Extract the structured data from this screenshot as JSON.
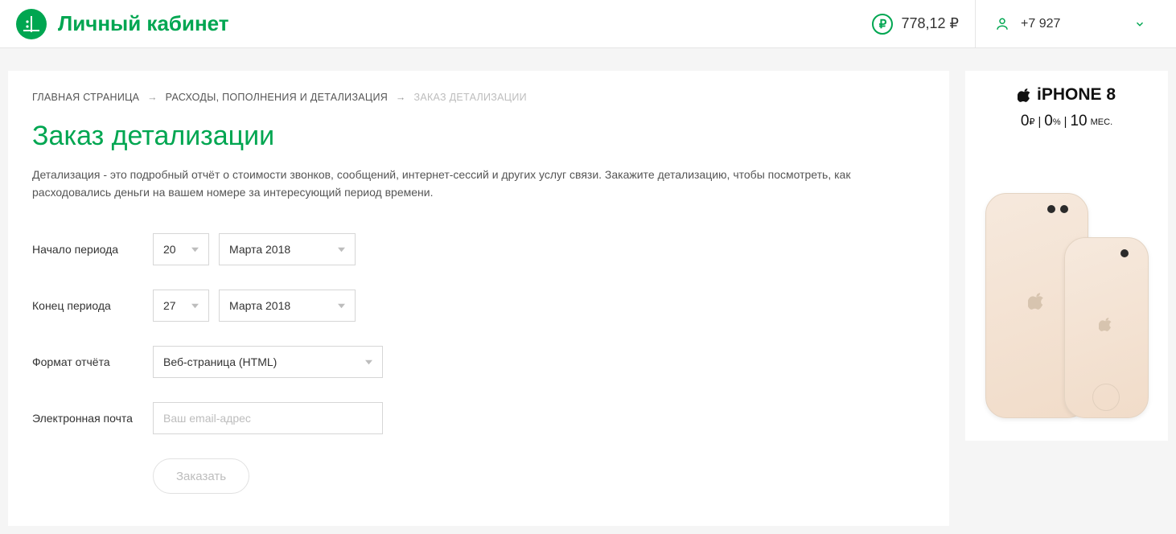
{
  "header": {
    "site_title": "Личный кабинет",
    "balance": "778,12 ₽",
    "account_phone": "+7 927"
  },
  "breadcrumbs": {
    "home": "ГЛАВНАЯ СТРАНИЦА",
    "section": "РАСХОДЫ, ПОПОЛНЕНИЯ И ДЕТАЛИЗАЦИЯ",
    "current": "ЗАКАЗ ДЕТАЛИЗАЦИИ"
  },
  "page": {
    "title": "Заказ детализации",
    "description": "Детализация - это подробный отчёт о стоимости звонков, сообщений, интернет-сессий и других услуг связи. Закажите детализацию, чтобы посмотреть, как расходовались деньги на вашем номере за интересующий период времени."
  },
  "form": {
    "start_label": "Начало периода",
    "start_day": "20",
    "start_month": "Марта 2018",
    "end_label": "Конец периода",
    "end_day": "27",
    "end_month": "Марта 2018",
    "format_label": "Формат отчёта",
    "format_value": "Веб-страница (HTML)",
    "email_label": "Электронная почта",
    "email_placeholder": "Ваш email-адрес",
    "submit_label": "Заказать"
  },
  "promo": {
    "title": "iPHONE 8",
    "terms_price": "0",
    "terms_price_unit": "₽",
    "terms_rate": "0",
    "terms_rate_unit": "%",
    "terms_months": "10",
    "terms_months_unit": "МЕС."
  }
}
